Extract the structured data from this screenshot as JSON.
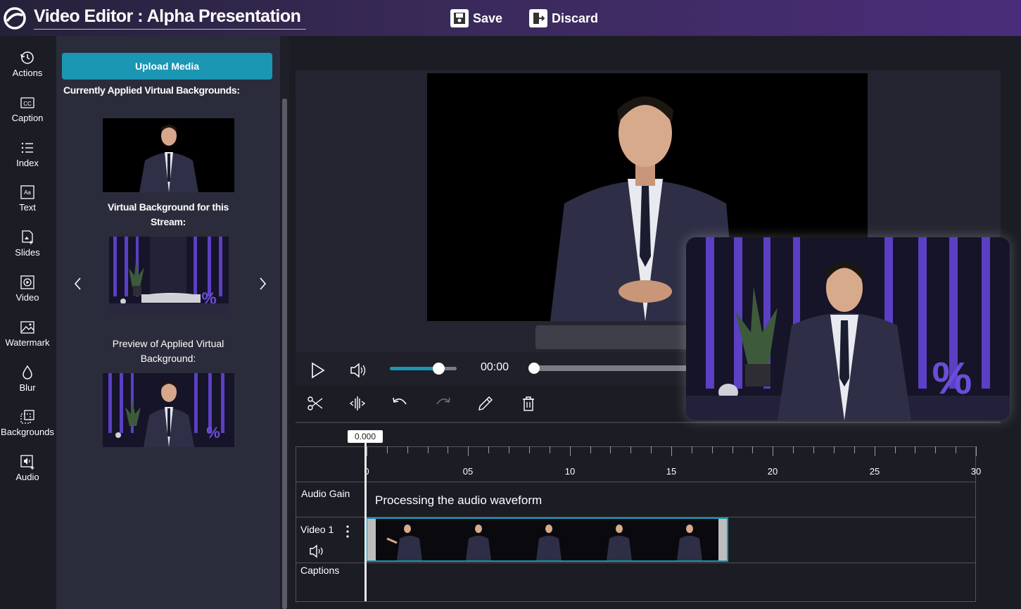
{
  "app": {
    "title": "Video Editor : Alpha Presentation"
  },
  "toolbar": {
    "save_label": "Save",
    "discard_label": "Discard"
  },
  "rail": {
    "items": [
      {
        "label": "Actions",
        "icon": "history-icon"
      },
      {
        "label": "Caption",
        "icon": "cc-icon"
      },
      {
        "label": "Index",
        "icon": "list-icon"
      },
      {
        "label": "Text",
        "icon": "text-aa-icon"
      },
      {
        "label": "Slides",
        "icon": "slides-icon"
      },
      {
        "label": "Video",
        "icon": "video-icon"
      },
      {
        "label": "Watermark",
        "icon": "image-icon"
      },
      {
        "label": "Blur",
        "icon": "droplet-icon"
      },
      {
        "label": "Backgrounds",
        "icon": "backgrounds-icon"
      },
      {
        "label": "Audio",
        "icon": "audio-file-icon"
      }
    ]
  },
  "panel": {
    "upload_label": "Upload Media",
    "applied_heading": "Currently Applied Virtual Backgrounds:",
    "stream_bg_caption_1": "Virtual Background for this",
    "stream_bg_caption_2": "Stream:",
    "preview_caption_1": "Preview of Applied Virtual",
    "preview_caption_2": "Background:"
  },
  "player": {
    "time": "00:00",
    "volume": 0.73,
    "progress": 0.0
  },
  "timeline": {
    "marker": "0.000",
    "ticks": [
      "0",
      "05",
      "10",
      "15",
      "20",
      "25",
      "30"
    ],
    "rows": {
      "audio_label": "Audio Gain",
      "audio_status": "Processing the audio waveform",
      "video_label": "Video 1",
      "captions_label": "Captions"
    }
  },
  "colors": {
    "accent": "#1b96b3",
    "topbar": "#4a2d7a",
    "panel": "#2b2c3b",
    "purple_bars": "#6a4ed8"
  }
}
